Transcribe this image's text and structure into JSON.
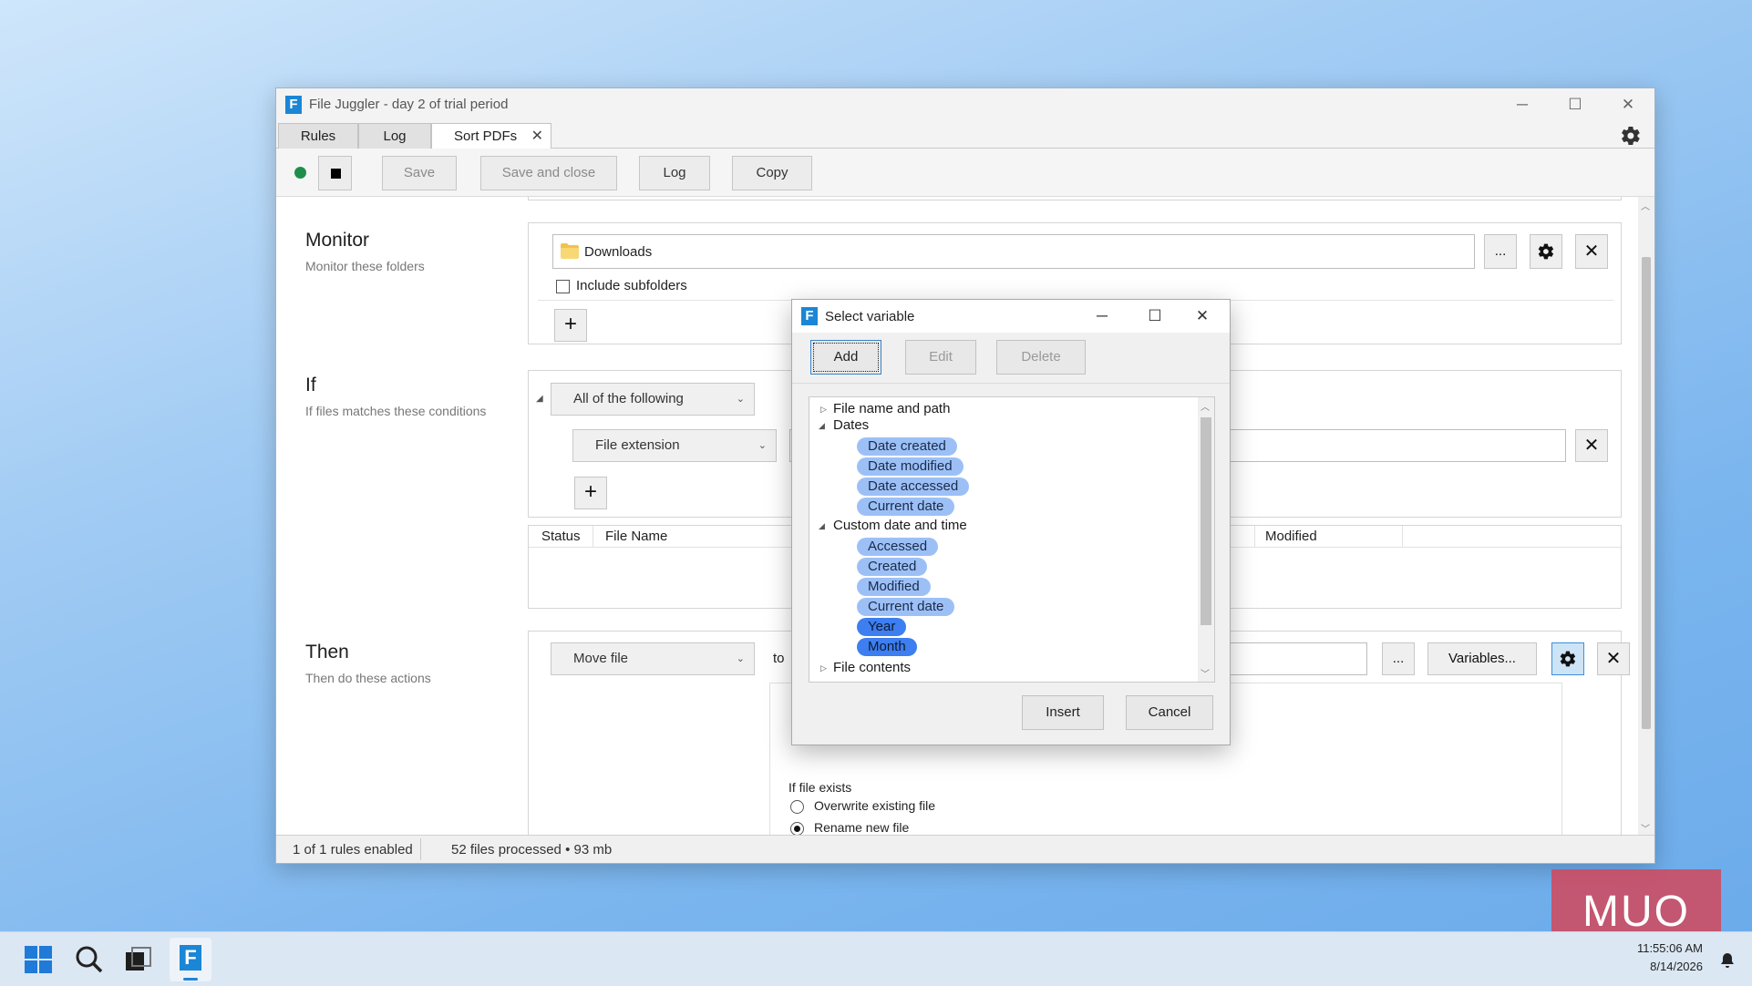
{
  "window": {
    "title": "File Juggler - day 2 of trial period",
    "logo_letter": "F",
    "minimize": "─",
    "maximize": "☐",
    "close": "✕"
  },
  "tabs": [
    {
      "label": "Rules"
    },
    {
      "label": "Log"
    },
    {
      "label": "Sort PDFs",
      "close": "✕"
    }
  ],
  "toolbar": {
    "save": "Save",
    "save_and_close": "Save and close",
    "log": "Log",
    "copy": "Copy",
    "status_color": "#1e8f4b"
  },
  "monitor": {
    "title": "Monitor",
    "subtitle": "Monitor these folders",
    "folder": "Downloads",
    "browse": "...",
    "include_subfolders": "Include subfolders",
    "add": "+"
  },
  "if_section": {
    "title": "If",
    "subtitle": "If files matches these conditions",
    "match_mode": "All of the following",
    "condition": "File extension",
    "add": "+",
    "table_headers": [
      "Status",
      "File Name",
      "Modified"
    ]
  },
  "then_section": {
    "title": "Then",
    "subtitle": "Then do these actions",
    "action": "Move file",
    "to_label": "to",
    "browse": "...",
    "variables": "Variables...",
    "if_file_exists": "If file exists",
    "overwrite": "Overwrite existing file",
    "rename": "Rename new file"
  },
  "statusbar": {
    "rules": "1 of 1 rules enabled",
    "files": "52 files processed • 93 mb"
  },
  "dialog": {
    "title": "Select variable",
    "add": "Add",
    "edit": "Edit",
    "delete": "Delete",
    "insert": "Insert",
    "cancel": "Cancel",
    "tree": {
      "file_name_and_path": "File name and path",
      "dates": "Dates",
      "date_items": [
        "Date created",
        "Date modified",
        "Date accessed",
        "Current date"
      ],
      "custom": "Custom date and time",
      "custom_items": [
        "Accessed",
        "Created",
        "Modified",
        "Current date",
        "Year",
        "Month"
      ],
      "file_contents": "File contents"
    }
  },
  "taskbar": {
    "time": "11:55:06 AM",
    "date": "8/14/2026"
  },
  "watermark": "MUO",
  "colors": {
    "accent": "#1b86d6",
    "chip_light": "#9cc0f6",
    "chip_dark": "#3d7ef0"
  }
}
